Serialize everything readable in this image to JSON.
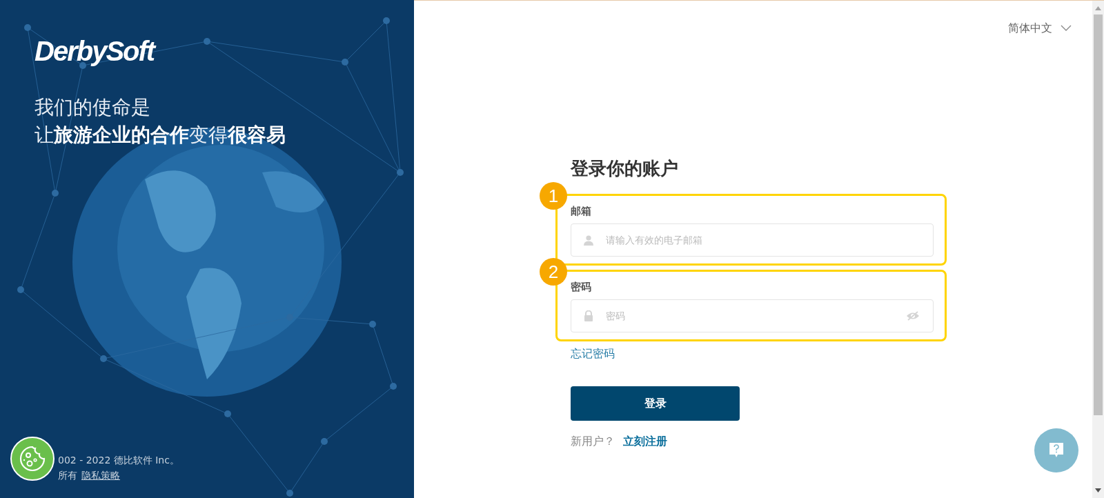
{
  "brand": {
    "logo": "DerbySoft"
  },
  "mission": [
    "我们的使命是",
    "让**旅游企业的合作**变得**很容易**"
  ],
  "footer": {
    "copyright": "002 - 2022 德比软件 Inc。",
    "rights": "所有",
    "privacy_link": "隐私策略"
  },
  "language": {
    "label": "简体中文"
  },
  "form": {
    "title": "登录你的账户",
    "fields": [
      {
        "step": "1",
        "label": "邮箱",
        "placeholder": "请输入有效的电子邮箱",
        "kind": "email"
      },
      {
        "step": "2",
        "label": "密码",
        "placeholder": "密码",
        "kind": "password"
      }
    ],
    "forgot": "忘记密码",
    "submit": "登录",
    "signup_prompt": "新用户？",
    "signup_link": "立刻注册"
  }
}
